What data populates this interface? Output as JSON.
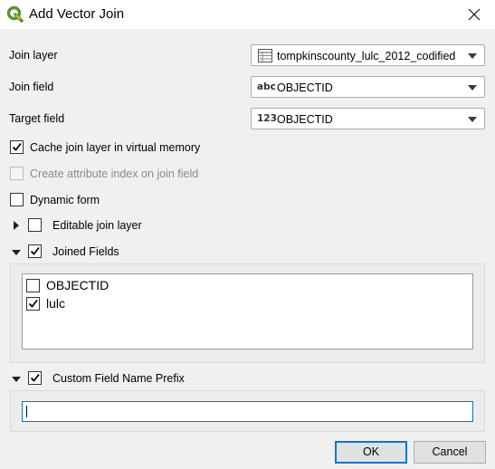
{
  "window": {
    "title": "Add Vector Join",
    "colors": {
      "titlebar": "#ffffff",
      "dialog_bg": "#f0f0f0",
      "focus_accent": "#0078d7",
      "qgis_green": "#589632",
      "qgis_yellow": "#f0c419"
    }
  },
  "form": {
    "join_layer": {
      "label": "Join layer",
      "value": "tompkinscounty_lulc_2012_codified",
      "icon": "vector-table-icon"
    },
    "join_field": {
      "label": "Join field",
      "type_tag": "abc",
      "value": "OBJECTID"
    },
    "target_field": {
      "label": "Target field",
      "type_tag": "123",
      "value": "OBJECTID"
    }
  },
  "options": {
    "cache_join": {
      "label": "Cache join layer in virtual memory",
      "checked": true
    },
    "create_index": {
      "label": "Create attribute index on join field",
      "checked": false,
      "enabled": false
    },
    "dynamic_form": {
      "label": "Dynamic form",
      "checked": false
    },
    "editable_join": {
      "label": "Editable join layer",
      "checked": false,
      "expanded": false
    }
  },
  "joined_fields": {
    "label": "Joined Fields",
    "checked": true,
    "expanded": true,
    "items": [
      {
        "label": "OBJECTID",
        "checked": false
      },
      {
        "label": "lulc",
        "checked": true
      }
    ]
  },
  "custom_prefix": {
    "label": "Custom Field Name Prefix",
    "checked": true,
    "expanded": true,
    "value": ""
  },
  "buttons": {
    "ok": "OK",
    "cancel": "Cancel"
  }
}
